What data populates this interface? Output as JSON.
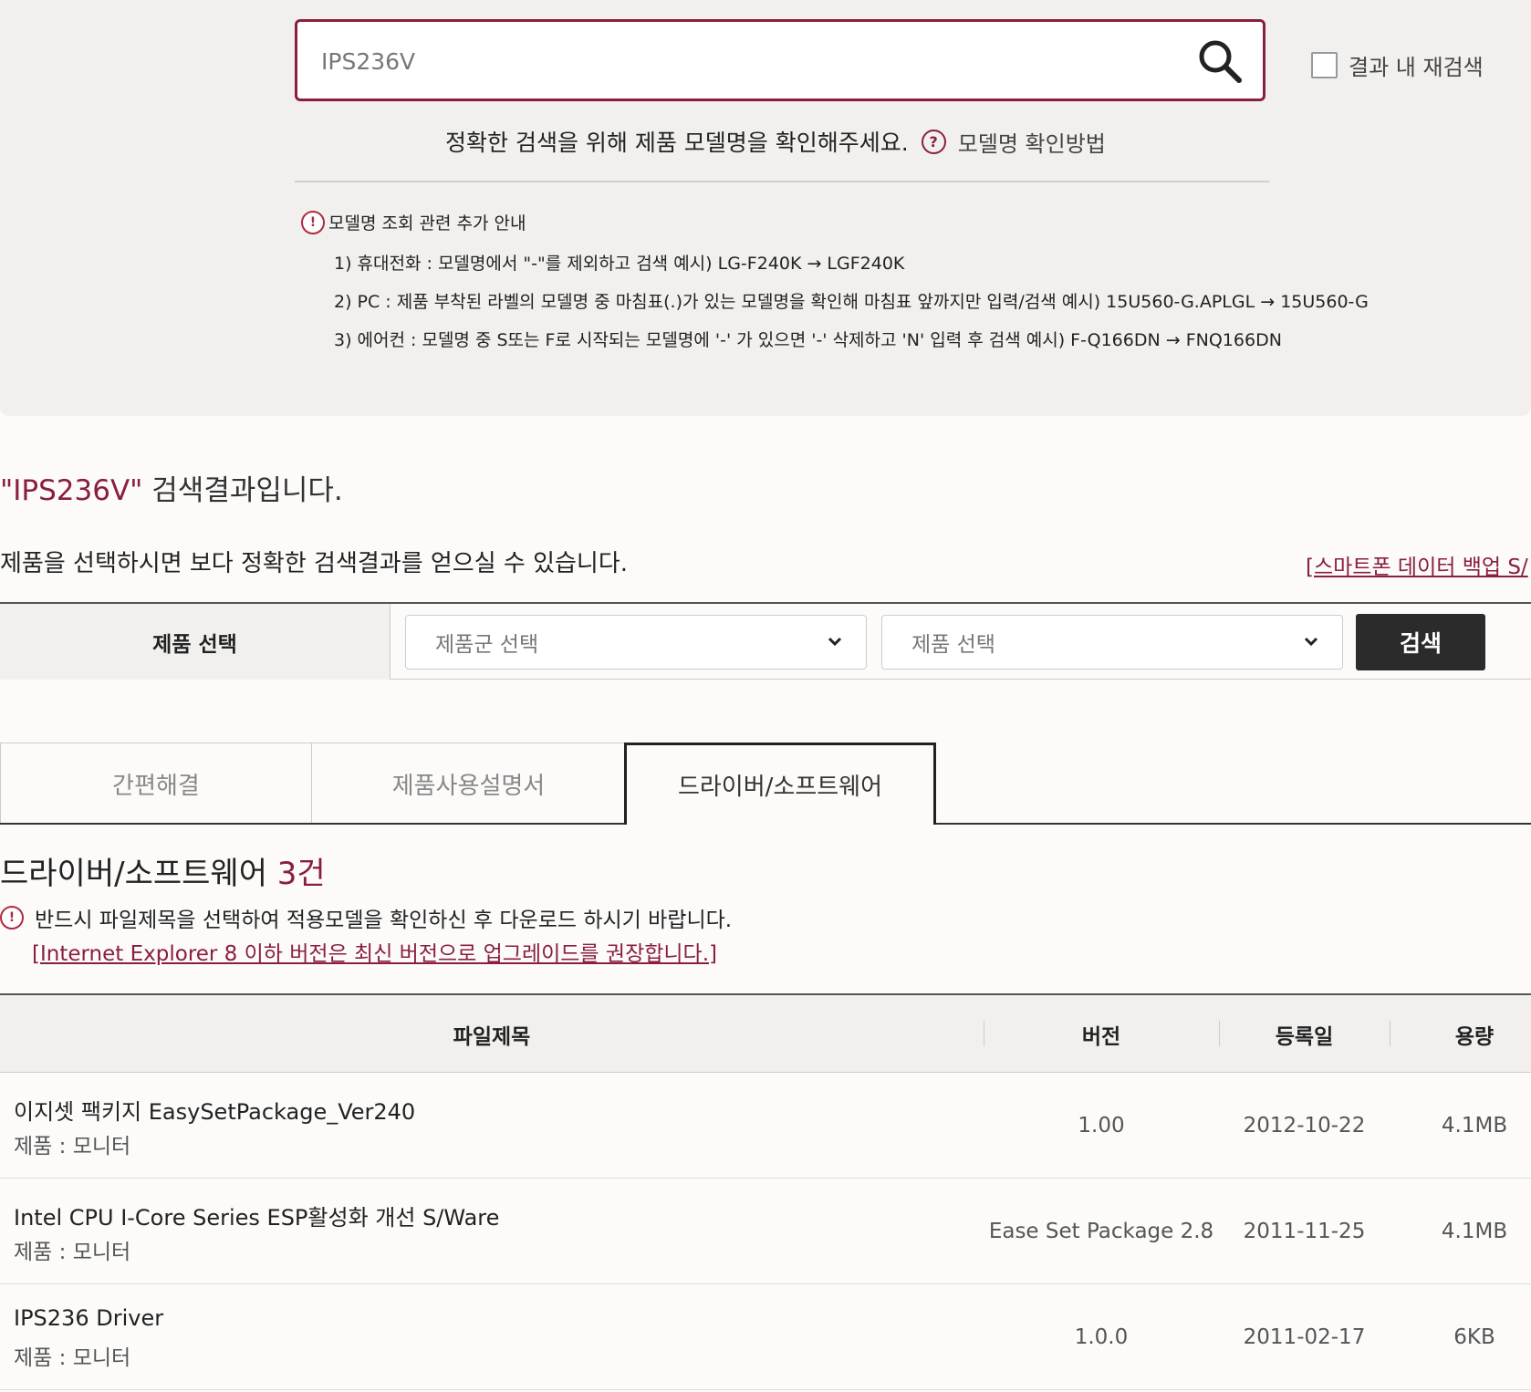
{
  "search": {
    "value": "IPS236V",
    "re_search_label": "결과 내 재검색",
    "guide_text": "정확한 검색을 위해 제품 모델명을 확인해주세요.",
    "guide_link": "모델명 확인방법"
  },
  "notice": {
    "title": "모델명 조회 관련 추가 안내",
    "items": [
      "1) 휴대전화 : 모델명에서 \"-\"를 제외하고 검색 예시) LG-F240K → LGF240K",
      "2) PC : 제품 부착된 라벨의 모델명 중 마침표(.)가 있는 모델명을 확인해 마침표 앞까지만 입력/검색 예시) 15U560-G.APLGL → 15U560-G",
      "3) 에어컨 : 모델명 중 S또는 F로 시작되는 모델명에 '-' 가 있으면 '-' 삭제하고 'N' 입력 후 검색 예시) F-Q166DN → FNQ166DN"
    ]
  },
  "result": {
    "keyword": "\"IPS236V\"",
    "suffix": " 검색결과입니다.",
    "hint": "제품을 선택하시면 보다 정확한 검색결과를 얻으실 수 있습니다.",
    "backup_link": "[스마트폰 데이터 백업 S/"
  },
  "product_select": {
    "label": "제품 선택",
    "group_placeholder": "제품군 선택",
    "product_placeholder": "제품 선택",
    "search_button": "검색"
  },
  "tabs": [
    "간편해결",
    "제품사용설명서",
    "드라이버/소프트웨어"
  ],
  "software": {
    "title": "드라이버/소프트웨어 ",
    "count": "3건",
    "warning": "반드시 파일제목을 선택하여 적용모델을 확인하신 후 다운로드 하시기 바랍니다.",
    "ie_link": "[Internet Explorer 8 이하 버전은 최신 버전으로 업그레이드를 권장합니다.]"
  },
  "table": {
    "headers": [
      "파일제목",
      "버전",
      "등록일",
      "용량"
    ],
    "rows": [
      {
        "name": "이지셋 팩키지 EasySetPackage_Ver240",
        "product": "제품 : 모니터",
        "version": "1.00",
        "date": "2012-10-22",
        "size": "4.1MB"
      },
      {
        "name": "Intel CPU I-Core Series ESP활성화 개선 S/Ware",
        "product": "제품 : 모니터",
        "version": "Ease Set Package 2.8",
        "date": "2011-11-25",
        "size": "4.1MB"
      },
      {
        "name": "IPS236 Driver",
        "product": "제품 : 모니터",
        "version": "1.0.0",
        "date": "2011-02-17",
        "size": "6KB"
      }
    ]
  },
  "colors": {
    "accent": "#8a1f3c",
    "button_dark": "#2b2b2b",
    "panel_bg": "#f1f0ee"
  },
  "icons": {
    "search": "search-icon",
    "question": "question-icon",
    "alert": "alert-icon",
    "chevron": "chevron-down-icon"
  }
}
